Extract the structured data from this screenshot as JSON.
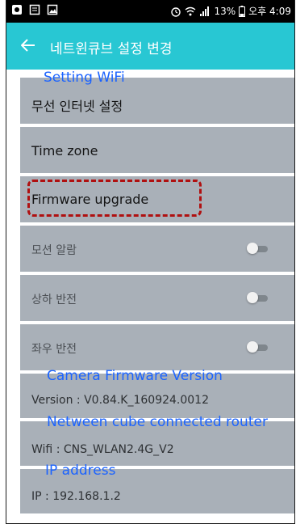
{
  "status_bar": {
    "battery": "13%",
    "time": "오후 4:09"
  },
  "app_bar": {
    "title": "네트윈큐브 설정 변경"
  },
  "settings": {
    "wifi_label": "무선 인터넷 설정",
    "timezone_label": "Time zone",
    "firmware_label": "Firmware upgrade",
    "motion_alarm_label": "모션 알람",
    "flip_vertical_label": "상하 반전",
    "flip_horizontal_label": "좌우 반전",
    "version_text": "Version : V0.84.K_160924.0012",
    "wifi_text": "Wifi : CNS_WLAN2.4G_V2",
    "ip_text": "IP : 192.168.1.2",
    "motion_alarm_on": false,
    "flip_vertical_on": false,
    "flip_horizontal_on": false
  },
  "annotations": {
    "setting_wifi": "Setting WiFi",
    "camera_firmware": "Camera Firmware Version",
    "router": "Netween cube connected router",
    "ip_address": "IP address",
    "annotation_color": "#1b63ff",
    "highlight_color": "#b01010"
  },
  "colors": {
    "app_bar": "#28c7d3",
    "row_background": "#a9b0b8"
  }
}
